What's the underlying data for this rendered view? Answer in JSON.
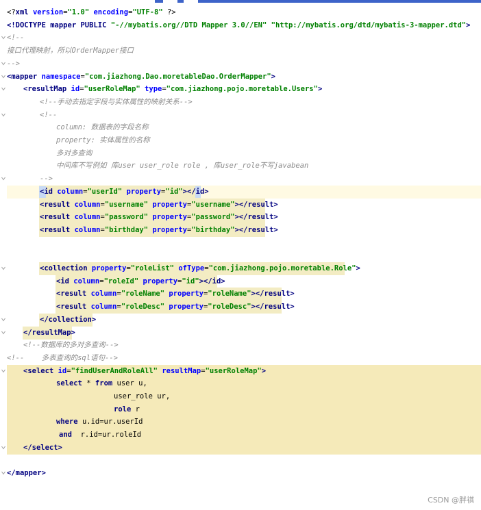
{
  "editor": {
    "watermark": "CSDN @胖祺",
    "colors": {
      "tag": "#000080",
      "attribute": "#0000ff",
      "value": "#008000",
      "comment": "#8c8c8c",
      "selection_highlight": "#f5eab9",
      "tag_highlight": "#f3ecc3",
      "caret_line": "#fffae3"
    },
    "lines": [
      [
        [
          "p",
          "<?"
        ],
        [
          "t",
          "xml "
        ],
        [
          "a",
          "version"
        ],
        [
          "p",
          "="
        ],
        [
          "v",
          "\"1.0\""
        ],
        [
          "p",
          " "
        ],
        [
          "a",
          "encoding"
        ],
        [
          "p",
          "="
        ],
        [
          "v",
          "\"UTF-8\""
        ],
        [
          "p",
          " ?>"
        ]
      ],
      [
        [
          "t",
          "<!DOCTYPE "
        ],
        [
          "t",
          "mapper "
        ],
        [
          "t",
          "PUBLIC "
        ],
        [
          "v",
          "\"-//mybatis.org//DTD Mapper 3.0//EN\""
        ],
        [
          "p",
          " "
        ],
        [
          "v",
          "\"http://mybatis.org/dtd/mybatis-3-mapper.dtd\""
        ],
        [
          "t",
          ">"
        ]
      ],
      [
        [
          "c",
          "<!--"
        ]
      ],
      [
        [
          "c",
          "接口代理映射，所以OrderMapper接口"
        ]
      ],
      [
        [
          "c",
          "-->"
        ]
      ],
      [
        [
          "t",
          "<mapper "
        ],
        [
          "a",
          "namespace"
        ],
        [
          "p",
          "="
        ],
        [
          "v",
          "\"com.jiazhong.Dao.moretableDao.OrderMapper\""
        ],
        [
          "t",
          ">"
        ]
      ],
      [
        [
          "t",
          "<resultMap "
        ],
        [
          "a",
          "id"
        ],
        [
          "p",
          "="
        ],
        [
          "v",
          "\"userRoleMap\""
        ],
        [
          "p",
          " "
        ],
        [
          "a",
          "type"
        ],
        [
          "p",
          "="
        ],
        [
          "v",
          "\"com.jiazhong.pojo.moretable.Users\""
        ],
        [
          "t",
          ">"
        ]
      ],
      [
        [
          "c",
          "<!--手动去指定字段与实体属性的映射关系-->"
        ]
      ],
      [
        [
          "c",
          "<!--"
        ]
      ],
      [
        [
          "c",
          "column: 数据表的字段名称"
        ]
      ],
      [
        [
          "c",
          "property: 实体属性的名称"
        ]
      ],
      [
        [
          "c",
          "多对多查询"
        ]
      ],
      [
        [
          "c",
          "中间库不写例如 库user user_role role , 库user_role不写javabean"
        ]
      ],
      [
        [
          "c",
          "-->"
        ]
      ],
      [
        [
          "t",
          "<id "
        ],
        [
          "a",
          "column"
        ],
        [
          "p",
          "="
        ],
        [
          "v",
          "\"userId\""
        ],
        [
          "p",
          " "
        ],
        [
          "a",
          "property"
        ],
        [
          "p",
          "="
        ],
        [
          "v",
          "\"id\""
        ],
        [
          "t",
          "></id>"
        ]
      ],
      [
        [
          "t",
          "<result "
        ],
        [
          "a",
          "column"
        ],
        [
          "p",
          "="
        ],
        [
          "v",
          "\"username\""
        ],
        [
          "p",
          " "
        ],
        [
          "a",
          "property"
        ],
        [
          "p",
          "="
        ],
        [
          "v",
          "\"username\""
        ],
        [
          "t",
          "></result>"
        ]
      ],
      [
        [
          "t",
          "<result "
        ],
        [
          "a",
          "column"
        ],
        [
          "p",
          "="
        ],
        [
          "v",
          "\"password\""
        ],
        [
          "p",
          " "
        ],
        [
          "a",
          "property"
        ],
        [
          "p",
          "="
        ],
        [
          "v",
          "\"password\""
        ],
        [
          "t",
          "></result>"
        ]
      ],
      [
        [
          "t",
          "<result "
        ],
        [
          "a",
          "column"
        ],
        [
          "p",
          "="
        ],
        [
          "v",
          "\"birthday\""
        ],
        [
          "p",
          " "
        ],
        [
          "a",
          "property"
        ],
        [
          "p",
          "="
        ],
        [
          "v",
          "\"birthday\""
        ],
        [
          "t",
          "></result>"
        ]
      ],
      [],
      [],
      [
        [
          "t",
          "<collection "
        ],
        [
          "a",
          "property"
        ],
        [
          "p",
          "="
        ],
        [
          "v",
          "\"roleList\""
        ],
        [
          "p",
          " "
        ],
        [
          "a",
          "ofType"
        ],
        [
          "p",
          "="
        ],
        [
          "v",
          "\"com.jiazhong.pojo.moretable.Role\""
        ],
        [
          "t",
          ">"
        ]
      ],
      [
        [
          "t",
          "<id "
        ],
        [
          "a",
          "column"
        ],
        [
          "p",
          "="
        ],
        [
          "v",
          "\"roleId\""
        ],
        [
          "p",
          " "
        ],
        [
          "a",
          "property"
        ],
        [
          "p",
          "="
        ],
        [
          "v",
          "\"id\""
        ],
        [
          "t",
          "></id>"
        ]
      ],
      [
        [
          "t",
          "<result "
        ],
        [
          "a",
          "column"
        ],
        [
          "p",
          "="
        ],
        [
          "v",
          "\"roleName\""
        ],
        [
          "p",
          " "
        ],
        [
          "a",
          "property"
        ],
        [
          "p",
          "="
        ],
        [
          "v",
          "\"roleName\""
        ],
        [
          "t",
          "></result>"
        ]
      ],
      [
        [
          "t",
          "<result "
        ],
        [
          "a",
          "column"
        ],
        [
          "p",
          "="
        ],
        [
          "v",
          "\"roleDesc\""
        ],
        [
          "p",
          " "
        ],
        [
          "a",
          "property"
        ],
        [
          "p",
          "="
        ],
        [
          "v",
          "\"roleDesc\""
        ],
        [
          "t",
          "></result>"
        ]
      ],
      [
        [
          "t",
          "</collection>"
        ]
      ],
      [
        [
          "t",
          "</resultMap>"
        ]
      ],
      [
        [
          "c",
          "<!--数据库的多对多查询-->"
        ]
      ],
      [
        [
          "c",
          "<!--    多表查询的sql语句-->"
        ]
      ],
      [
        [
          "t",
          "<select "
        ],
        [
          "a",
          "id"
        ],
        [
          "p",
          "="
        ],
        [
          "v",
          "\"findUserAndRoleAll\""
        ],
        [
          "p",
          " "
        ],
        [
          "a",
          "resultMap"
        ],
        [
          "p",
          "="
        ],
        [
          "v",
          "\"userRoleMap\""
        ],
        [
          "t",
          ">"
        ]
      ],
      [
        [
          "t",
          "select "
        ],
        [
          "p",
          "* "
        ],
        [
          "t",
          "from "
        ],
        [
          "p",
          "user u,"
        ]
      ],
      [
        [
          "p",
          "user_role ur,"
        ]
      ],
      [
        [
          "t",
          "role "
        ],
        [
          "p",
          "r"
        ]
      ],
      [
        [
          "t",
          "where "
        ],
        [
          "p",
          "u.id=ur.userId"
        ]
      ],
      [
        [
          "t",
          "and  "
        ],
        [
          "p",
          "r.id=ur.roleId"
        ]
      ],
      [
        [
          "t",
          "</select>"
        ]
      ],
      [],
      [
        [
          "t",
          "</mapper>"
        ]
      ]
    ]
  }
}
